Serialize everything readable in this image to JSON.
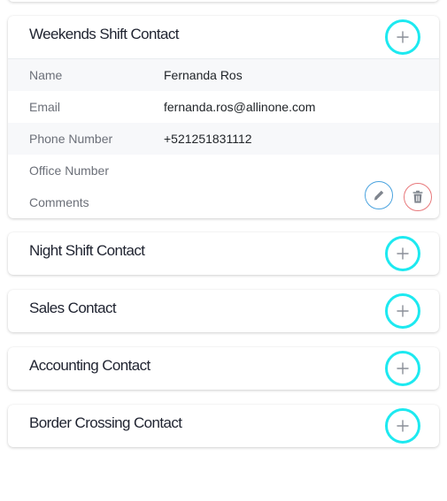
{
  "expanded_card": {
    "title": "Weekends Shift Contact",
    "fields": [
      {
        "label": "Name",
        "value": "Fernanda Ros"
      },
      {
        "label": "Email",
        "value": "fernanda.ros@allinone.com"
      },
      {
        "label": "Phone Number",
        "value": "+521251831112"
      },
      {
        "label": "Office Number",
        "value": ""
      },
      {
        "label": "Comments",
        "value": ""
      }
    ]
  },
  "collapsed_cards": [
    {
      "title": "Night Shift Contact"
    },
    {
      "title": "Sales Contact"
    },
    {
      "title": "Accounting Contact"
    },
    {
      "title": "Border Crossing Contact"
    }
  ],
  "icons": {
    "add": "plus-icon",
    "edit": "pencil-icon",
    "delete": "trash-icon"
  },
  "colors": {
    "add_ring": "#1de9f0",
    "edit_blue": "#4aa3df",
    "delete_red": "#e8787b"
  }
}
